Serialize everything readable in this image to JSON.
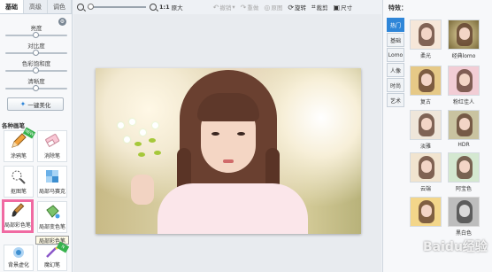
{
  "left_panel": {
    "tabs": [
      "基础",
      "高级",
      "调色"
    ],
    "sliders": [
      {
        "label": "亮度",
        "value_pct": 50
      },
      {
        "label": "对比度",
        "value_pct": 50
      },
      {
        "label": "色彩饱和度",
        "value_pct": 50
      },
      {
        "label": "清晰度",
        "value_pct": 50
      }
    ],
    "one_key_label": "一键美化",
    "section_title": "各种画笔",
    "tools": [
      {
        "label": "涂鸦笔",
        "icon": "pencil-icon",
        "badge": "NEW"
      },
      {
        "label": "消除笔",
        "icon": "eraser-icon"
      },
      {
        "label": "抠图笔",
        "icon": "cutout-pen-icon"
      },
      {
        "label": "局部马赛克",
        "icon": "mosaic-icon"
      },
      {
        "label": "局部彩色笔",
        "icon": "color-brush-icon",
        "selected": true
      },
      {
        "label": "局部变色笔",
        "icon": "recolor-bucket-icon"
      },
      {
        "label": "背景虚化",
        "icon": "blur-icon"
      },
      {
        "label": "魔幻笔",
        "icon": "magic-pen-icon"
      }
    ],
    "tooltip": "局部彩色笔"
  },
  "toolbar": {
    "zoom_value_pct": 0,
    "one_to_one": "1:1",
    "original": "原大",
    "undo": "撤销",
    "redo": "重做",
    "original_image": "原图",
    "rotate": "旋转",
    "crop": "裁剪",
    "resize": "尺寸"
  },
  "right_panel": {
    "title": "特效：",
    "categories": [
      "热门",
      "基础",
      "Lomo",
      "人像",
      "时尚",
      "艺术"
    ],
    "effects": [
      "柔光",
      "经典lomo",
      "复古",
      "粉红佳人",
      "淡雅",
      "HDR",
      "云端",
      "阿宝色",
      "",
      "黑白色"
    ]
  },
  "watermark": "Baidu经验",
  "colors": {
    "accent": "#2f86d8",
    "selected_tool_border": "#f06aa2"
  }
}
